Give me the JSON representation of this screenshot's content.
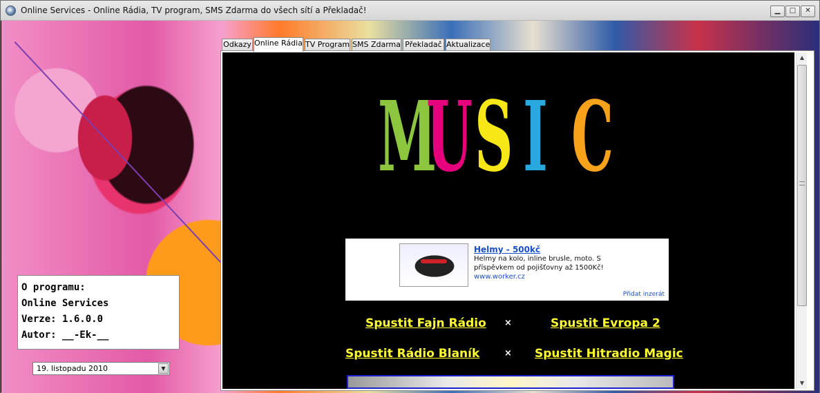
{
  "window": {
    "title": "Online Services - Online Rádia, TV program, SMS Zdarma do všech sítí a Překladač!",
    "min_glyph": "▁",
    "max_glyph": "□",
    "close_glyph": "✕"
  },
  "about": {
    "heading": "O programu:",
    "name": "Online Services",
    "version": "Verze: 1.6.0.0",
    "author": "Autor: __-Ek-__"
  },
  "date_picker": {
    "value": "19. listopadu 2010",
    "arrow": "▼"
  },
  "tabs": [
    {
      "label": "Odkazy"
    },
    {
      "label": "Online Rádia"
    },
    {
      "label": "TV Program"
    },
    {
      "label": "SMS Zdarma"
    },
    {
      "label": "Překladač"
    },
    {
      "label": "Aktualizace"
    }
  ],
  "active_tab": "Online Rádia",
  "music_logo": {
    "letters": [
      "M",
      "U",
      "S",
      "I",
      "C"
    ],
    "colors": [
      "#8cc63f",
      "#e6007e",
      "#f7e716",
      "#29a8e0",
      "#f7a21b"
    ]
  },
  "ad": {
    "title": "Helmy - 500kč",
    "line1": "Helmy na kolo, inline brusle, moto. S",
    "line2": "příspěvkem od pojišťovny až 1500Kč!",
    "url": "www.worker.cz",
    "add_link": "Přidat inzerát"
  },
  "radio": {
    "fajn": "Spustit Fajn Rádio",
    "evropa": "Spustit Evropa 2",
    "blanik": "Spustit Rádio Blaník",
    "hitradio": "Spustit Hitradio Magic",
    "separator": "×"
  },
  "scrollbar": {
    "up": "▲",
    "down": "▼"
  },
  "colors": {
    "link_yellow": "#ffff33",
    "ad_blue": "#1a4fc4",
    "content_bg": "#000000"
  }
}
